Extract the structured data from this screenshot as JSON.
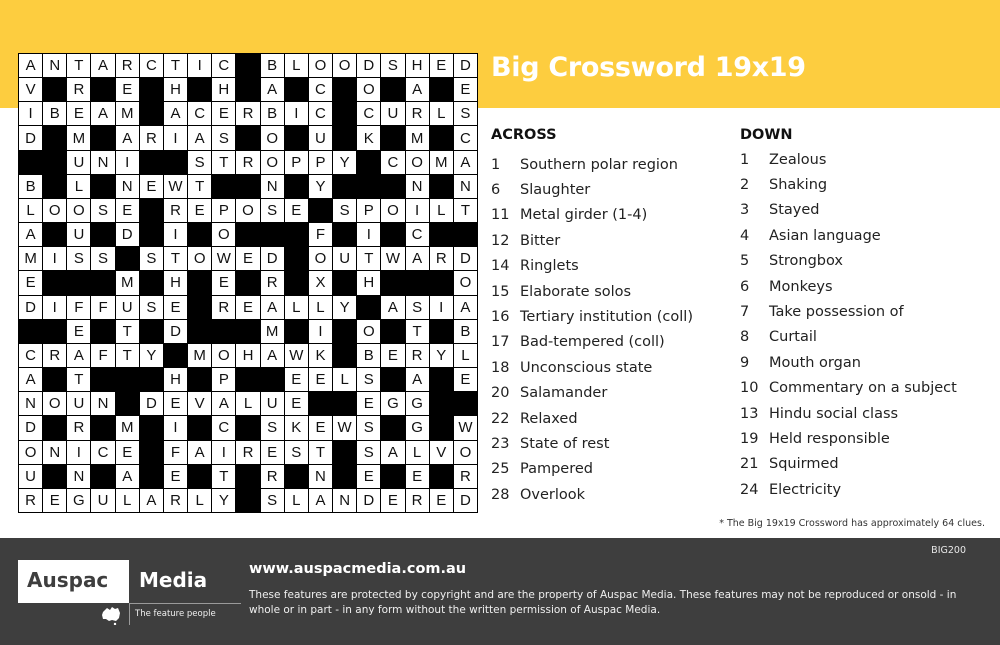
{
  "header": {
    "title": "Big Crossword 19x19",
    "accent_color": "#fdcd3f"
  },
  "grid": {
    "size": 19,
    "rows": [
      "ANTARCTIC#BLOODSHED",
      "V#R#E#H#H#A#C#O#A#E",
      "IBEAM#ACERBIC#CURLS",
      "D#M#ARIAS#O#U#K#M#C",
      "##UNI##STROPPY#COMA",
      "B#L#NEWT##N#Y###N#N",
      "LOOSE#REPOSE#SPOILT",
      "A#U#D#I#O###F#I#C##",
      "MISS#STOWED#OUTWARD",
      "E###M#H#E#R#X#H###O",
      "DIFFUSE#REALLY#ASIA",
      "##E#T#D###M#I#O#T#B",
      "CRAFTY#MOHAWK#BERYL",
      "A#T###H#P##EELS#A#E",
      "NOUN#DEVALUE##EGG##",
      "D#R#M#I#C#SKEWS#G#W",
      "ONICE#FAIREST#SALVO",
      "U#N#A#E#T#R#N#E#E#R",
      "REGULARLY#SLANDERED"
    ]
  },
  "across": {
    "heading": "ACROSS",
    "clues": [
      {
        "num": "1",
        "text": "Southern polar region"
      },
      {
        "num": "6",
        "text": "Slaughter"
      },
      {
        "num": "11",
        "text": "Metal girder (1-4)"
      },
      {
        "num": "12",
        "text": "Bitter"
      },
      {
        "num": "14",
        "text": "Ringlets"
      },
      {
        "num": "15",
        "text": "Elaborate solos"
      },
      {
        "num": "16",
        "text": "Tertiary institution (coll)"
      },
      {
        "num": "17",
        "text": "Bad-tempered (coll)"
      },
      {
        "num": "18",
        "text": "Unconscious state"
      },
      {
        "num": "20",
        "text": "Salamander"
      },
      {
        "num": "22",
        "text": "Relaxed"
      },
      {
        "num": "23",
        "text": "State of rest"
      },
      {
        "num": "25",
        "text": "Pampered"
      },
      {
        "num": "28",
        "text": "Overlook"
      }
    ]
  },
  "down": {
    "heading": "DOWN",
    "clues": [
      {
        "num": "1",
        "text": "Zealous"
      },
      {
        "num": "2",
        "text": "Shaking"
      },
      {
        "num": "3",
        "text": "Stayed"
      },
      {
        "num": "4",
        "text": "Asian language"
      },
      {
        "num": "5",
        "text": "Strongbox"
      },
      {
        "num": "6",
        "text": "Monkeys"
      },
      {
        "num": "7",
        "text": "Take possession of"
      },
      {
        "num": "8",
        "text": "Curtail"
      },
      {
        "num": "9",
        "text": "Mouth organ"
      },
      {
        "num": "10",
        "text": "Commentary on a subject"
      },
      {
        "num": "13",
        "text": "Hindu social class"
      },
      {
        "num": "19",
        "text": "Held responsible"
      },
      {
        "num": "21",
        "text": "Squirmed"
      },
      {
        "num": "24",
        "text": "Electricity"
      }
    ]
  },
  "note": "* The Big 19x19 Crossword has approximately 64 clues.",
  "footer": {
    "code": "BIG200",
    "logo_left": "Auspac",
    "logo_right": "Media",
    "logo_icon": "australia-map-icon",
    "tagline": "The feature people",
    "website": "www.auspacmedia.com.au",
    "legal": "These features are protected by copyright and are the property of Auspac Media. These features may not be reproduced or onsold - in whole or in part - in any form without the written permission of Auspac Media."
  }
}
